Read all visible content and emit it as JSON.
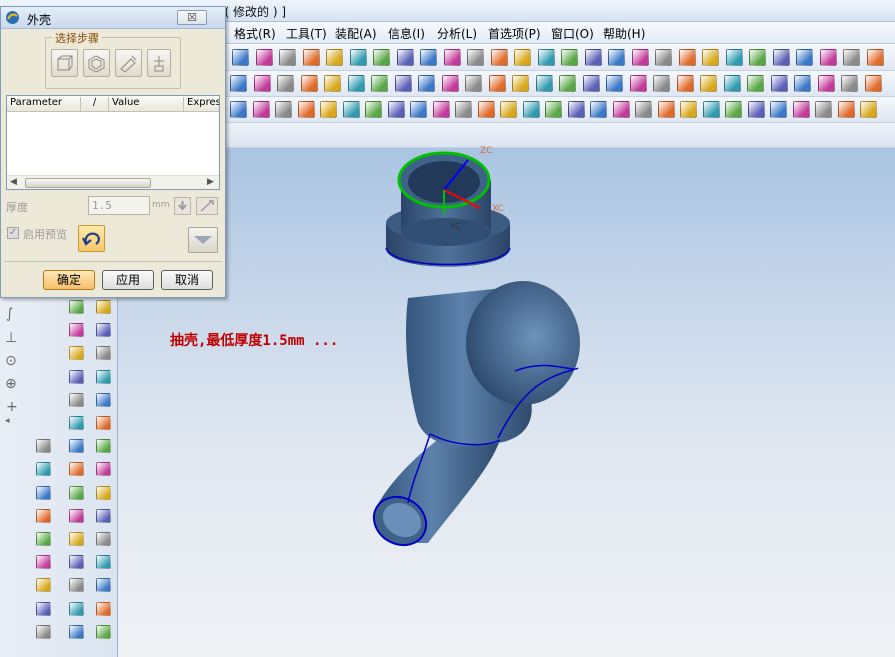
{
  "window": {
    "title_suffix": "t ( 修改的 ) ]"
  },
  "menu": {
    "items": [
      "格式(R)",
      "工具(T)",
      "装配(A)",
      "信息(I)",
      "分析(L)",
      "首选项(P)",
      "窗口(O)",
      "帮助(H)"
    ]
  },
  "dialog": {
    "title": "外壳",
    "close_label": "☒",
    "steps_label": "选择步骤",
    "steps": [
      {
        "icon": "remove-face-icon"
      },
      {
        "icon": "shell-body-icon"
      },
      {
        "icon": "alternate-thickness-icon"
      },
      {
        "icon": "failure-point-icon"
      }
    ],
    "table": {
      "headers": [
        "Parameter",
        "/",
        "Value",
        "Expres"
      ]
    },
    "thickness": {
      "label": "厚度",
      "value": "1.5",
      "unit": "mm"
    },
    "preview_label": "启用预览",
    "buttons": {
      "ok": "确定",
      "apply": "应用",
      "cancel": "取消"
    }
  },
  "viewport": {
    "annotation": "抽壳,最低厚度1.5mm ...",
    "axes": {
      "zc": "ZC",
      "xc": "XC",
      "yc": "YC"
    }
  },
  "colors": {
    "model_base": "#4a6d93",
    "edge_highlight": "#00c000",
    "edge": "#0000c8",
    "annotation": "#c00000"
  }
}
